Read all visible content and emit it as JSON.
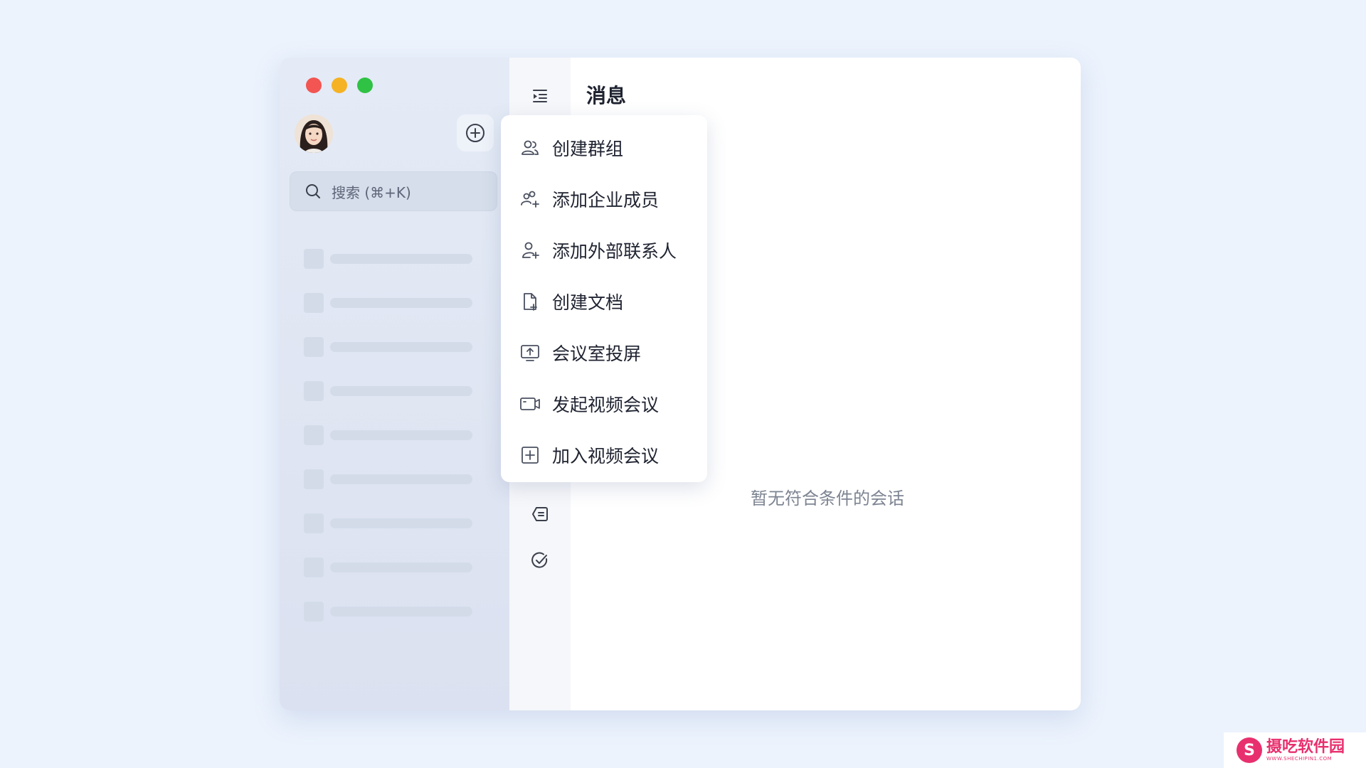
{
  "window": {
    "traffic_lights": [
      "close",
      "minimize",
      "maximize"
    ]
  },
  "sidebar": {
    "avatar": "user-avatar",
    "add_icon": "plus-circle-icon",
    "search": {
      "placeholder": "搜索 (⌘+K)",
      "icon": "search-icon"
    },
    "skeleton_rows": 9
  },
  "rail": {
    "icons": [
      "indent-icon",
      "list-icon",
      "check-circle-icon"
    ]
  },
  "main": {
    "title": "消息",
    "empty_text": "暂无符合条件的会话"
  },
  "menu": {
    "items": [
      {
        "label": "创建群组",
        "icon": "group-icon"
      },
      {
        "label": "添加企业成员",
        "icon": "add-members-icon"
      },
      {
        "label": "添加外部联系人",
        "icon": "add-contact-icon"
      },
      {
        "label": "创建文档",
        "icon": "new-document-icon"
      },
      {
        "label": "会议室投屏",
        "icon": "screen-share-icon"
      },
      {
        "label": "发起视频会议",
        "icon": "video-camera-icon"
      },
      {
        "label": "加入视频会议",
        "icon": "join-meeting-icon"
      }
    ]
  },
  "watermark": {
    "text": "摄吃软件园",
    "sub": "WWW.SHECHIPIN1.COM"
  }
}
